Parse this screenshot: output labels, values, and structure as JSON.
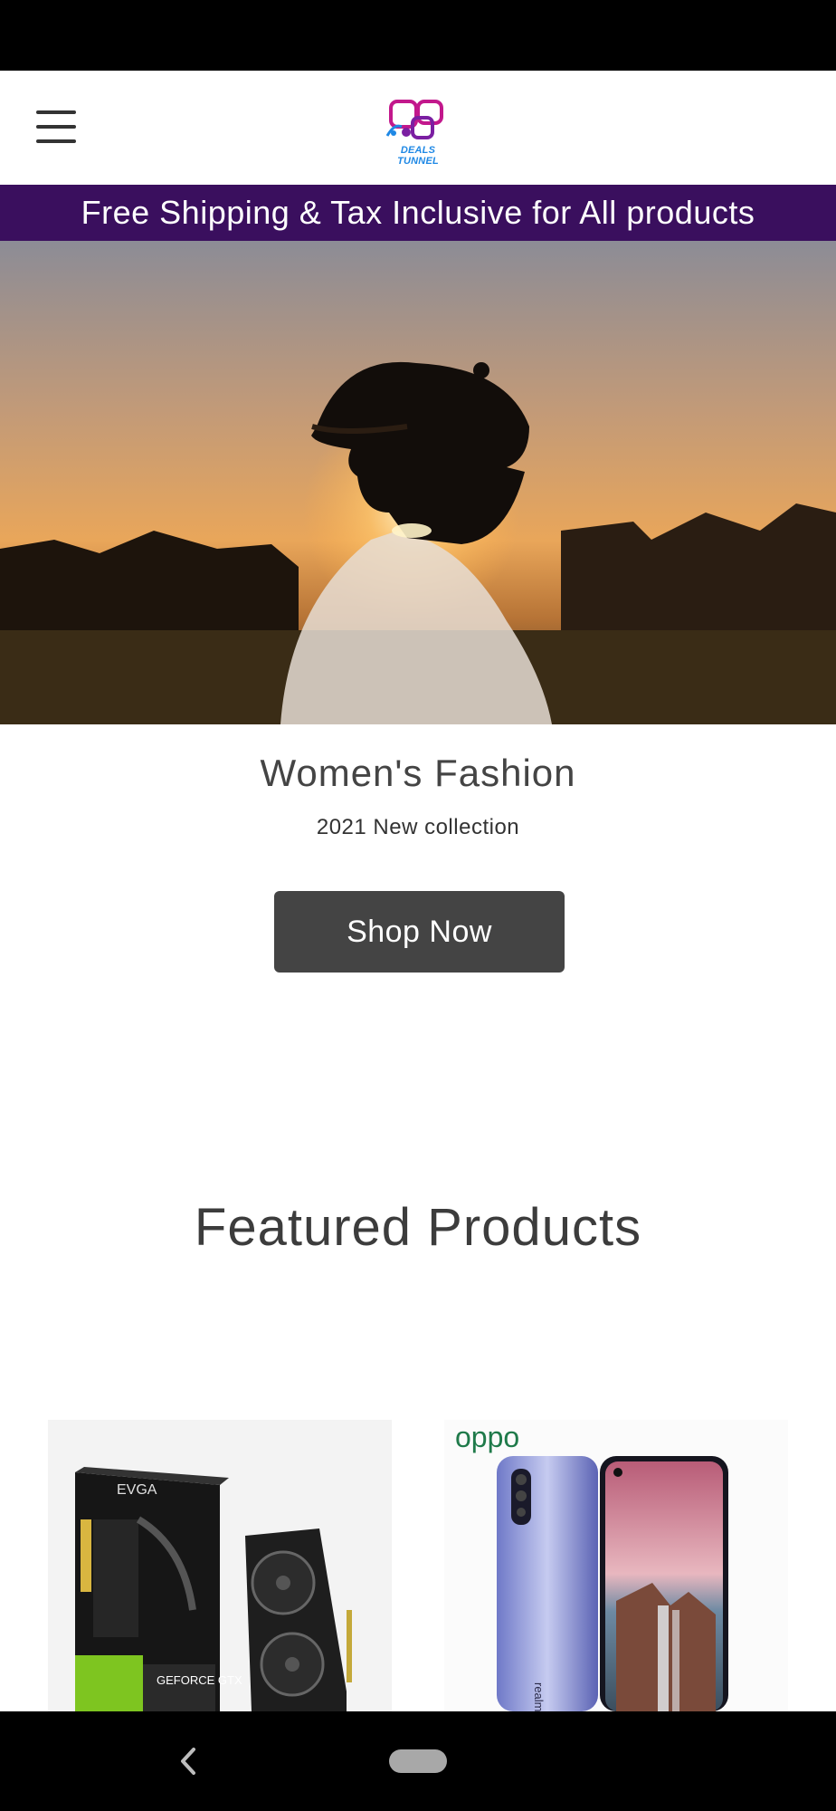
{
  "header": {
    "logo_text": "DEALS TUNNEL",
    "menu_icon": "hamburger-menu-icon"
  },
  "promo_banner": {
    "text": "Free Shipping & Tax Inclusive for All products"
  },
  "hero": {
    "title": "Women's Fashion",
    "subtitle": "2021 New collection",
    "button_label": "Shop Now"
  },
  "featured": {
    "title": "Featured Products",
    "products": [
      {
        "brand_label": "EVGA",
        "model_label": "GEFORCE GTX",
        "image": "graphics-card-image"
      },
      {
        "brand_label": "oppo",
        "side_label": "realme",
        "image": "smartphone-image"
      }
    ]
  },
  "nav_bar": {
    "back_icon": "back-chevron-icon",
    "home_icon": "home-pill-icon"
  },
  "colors": {
    "promo_background": "#3a0f5e",
    "button_background": "#444444",
    "logo_magenta": "#c2188c",
    "logo_blue": "#1e88e5"
  }
}
